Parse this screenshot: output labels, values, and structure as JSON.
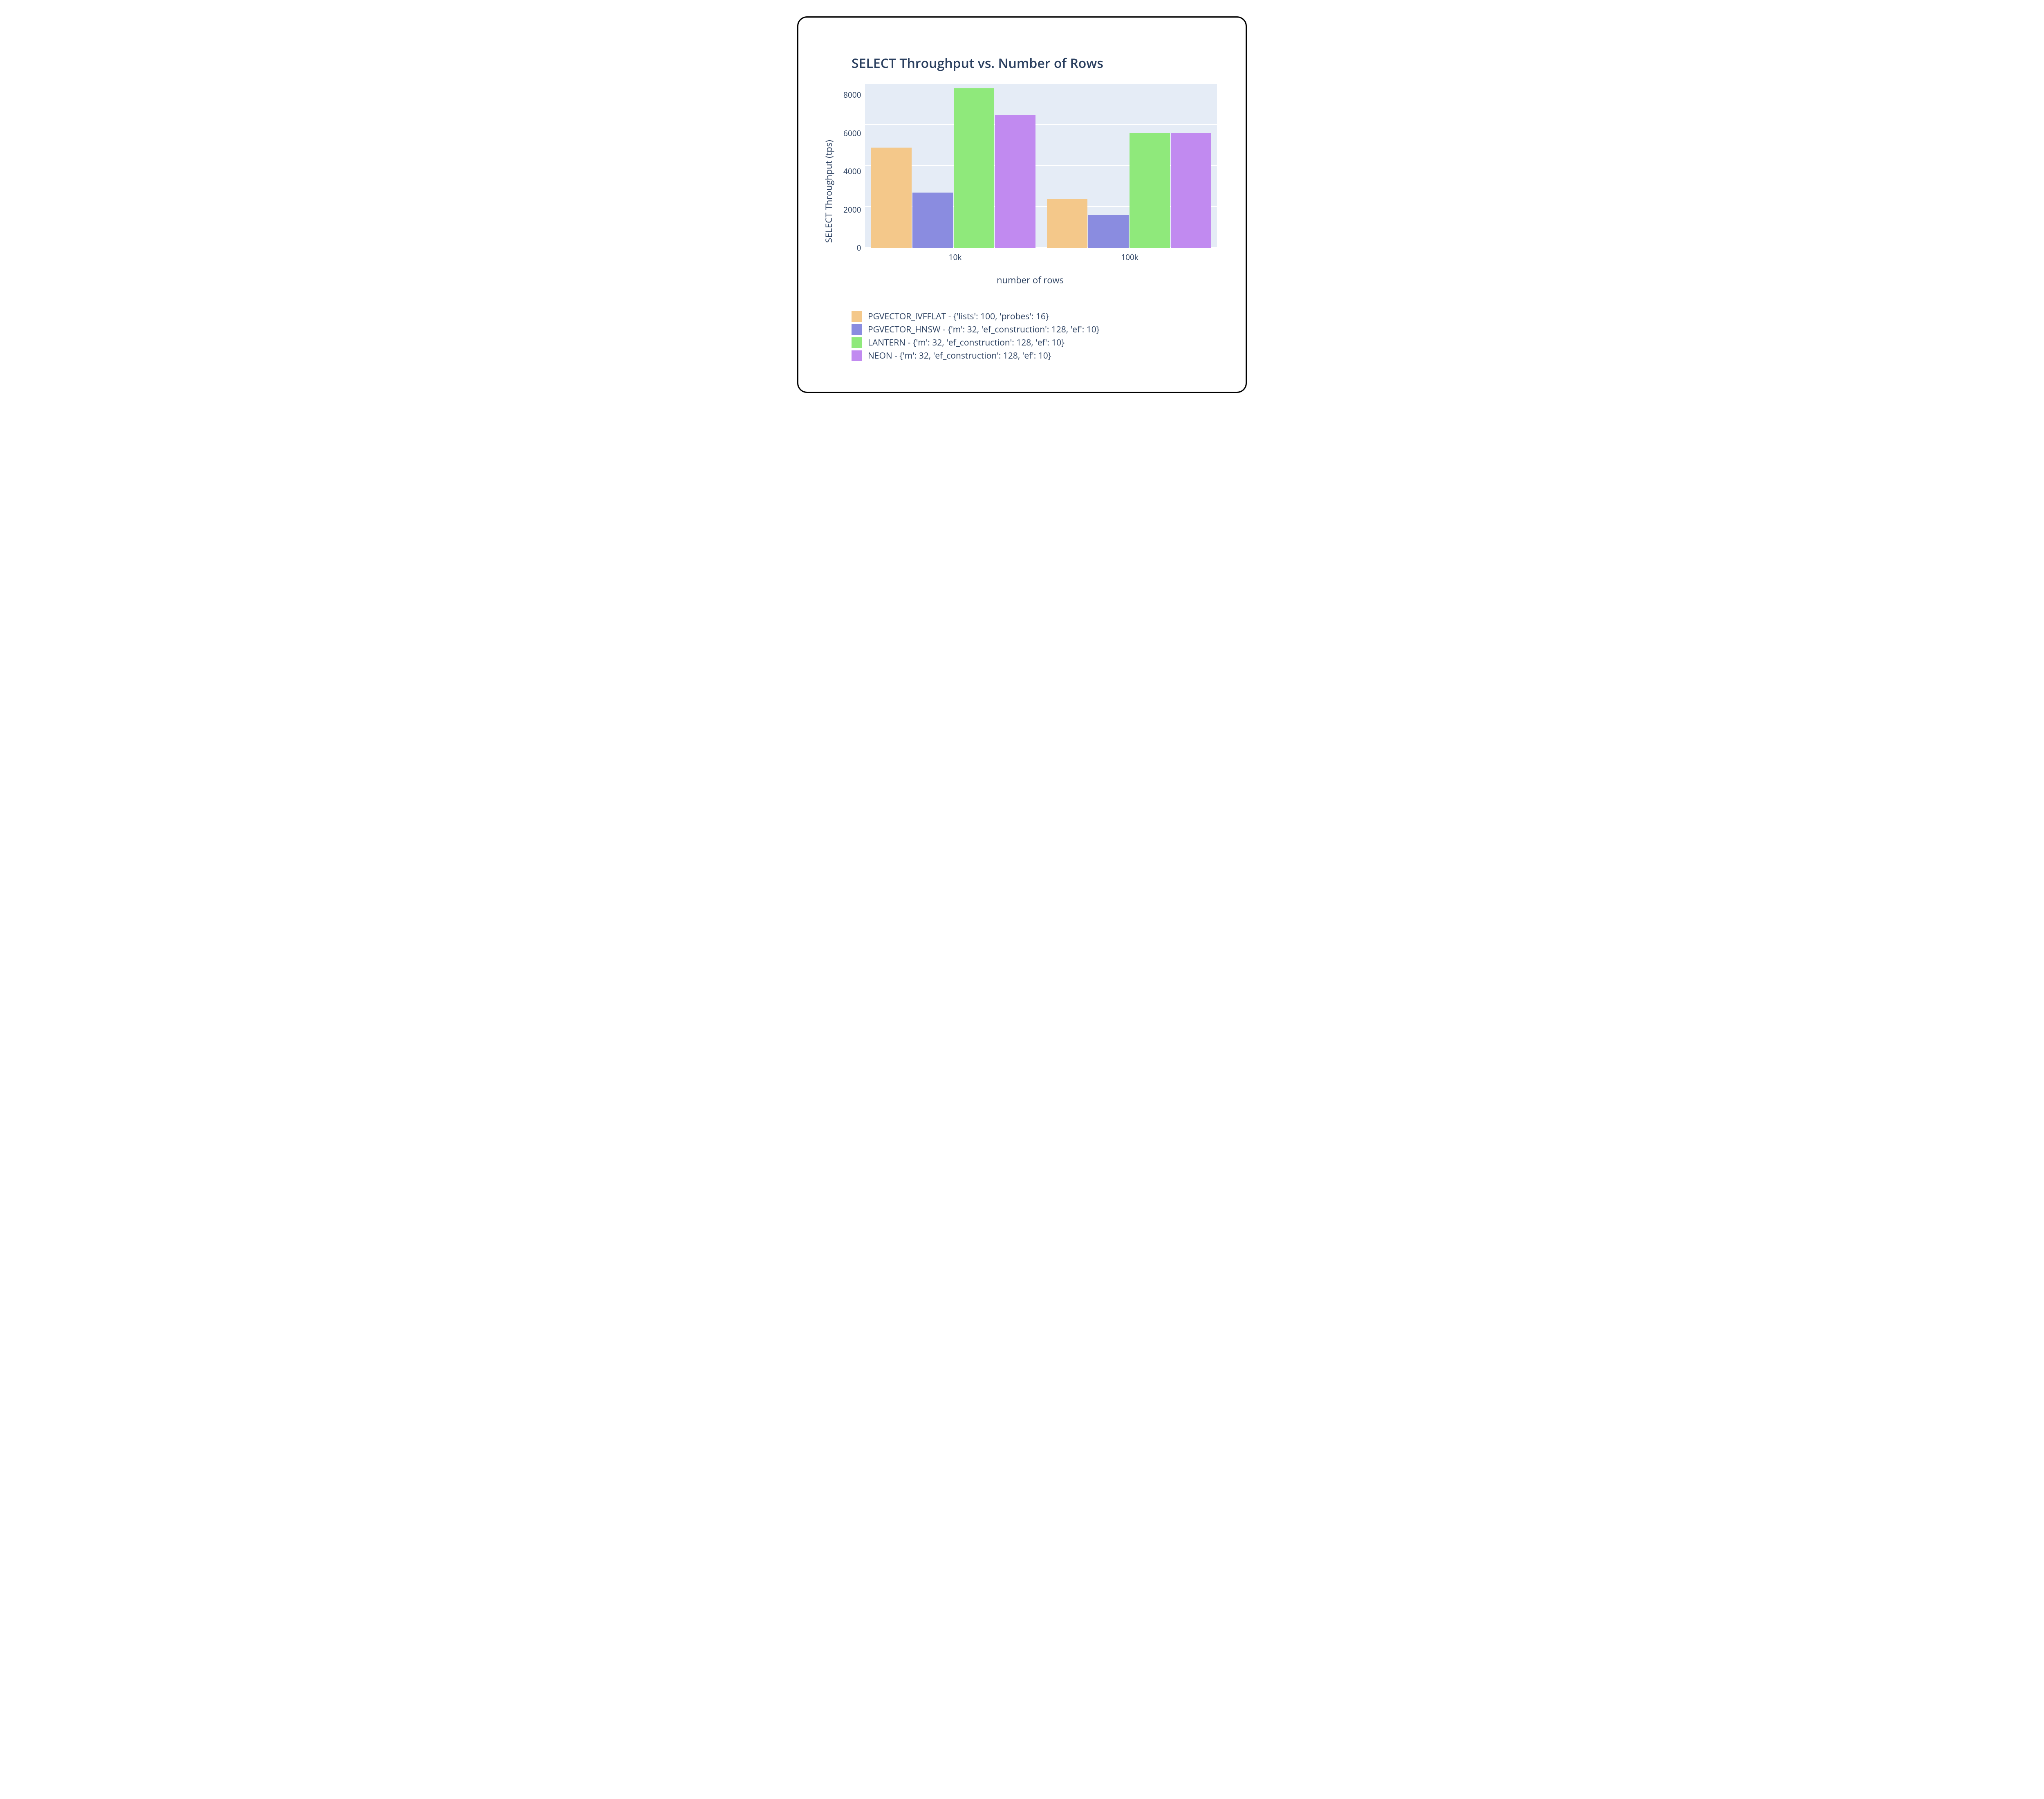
{
  "chart_data": {
    "type": "bar",
    "title": "SELECT Throughput vs. Number of Rows",
    "xlabel": "number of rows",
    "ylabel": "SELECT Throughput (tps)",
    "categories": [
      "10k",
      "100k"
    ],
    "ylim": [
      0,
      8000
    ],
    "yticks": [
      0,
      2000,
      4000,
      6000,
      8000
    ],
    "series": [
      {
        "name": "PGVECTOR_IVFFLAT - {'lists': 100, 'probes': 16}",
        "color": "#f4c88a",
        "values": [
          4900,
          2400
        ]
      },
      {
        "name": "PGVECTOR_HNSW - {'m': 32, 'ef_construction': 128, 'ef': 10}",
        "color": "#8a8ce0",
        "values": [
          2700,
          1600
        ]
      },
      {
        "name": "LANTERN - {'m': 32, 'ef_construction': 128, 'ef': 10}",
        "color": "#8fe97b",
        "values": [
          7800,
          5600
        ]
      },
      {
        "name": "NEON - {'m': 32, 'ef_construction': 128, 'ef': 10}",
        "color": "#c18af0",
        "values": [
          6500,
          5600
        ]
      }
    ]
  }
}
